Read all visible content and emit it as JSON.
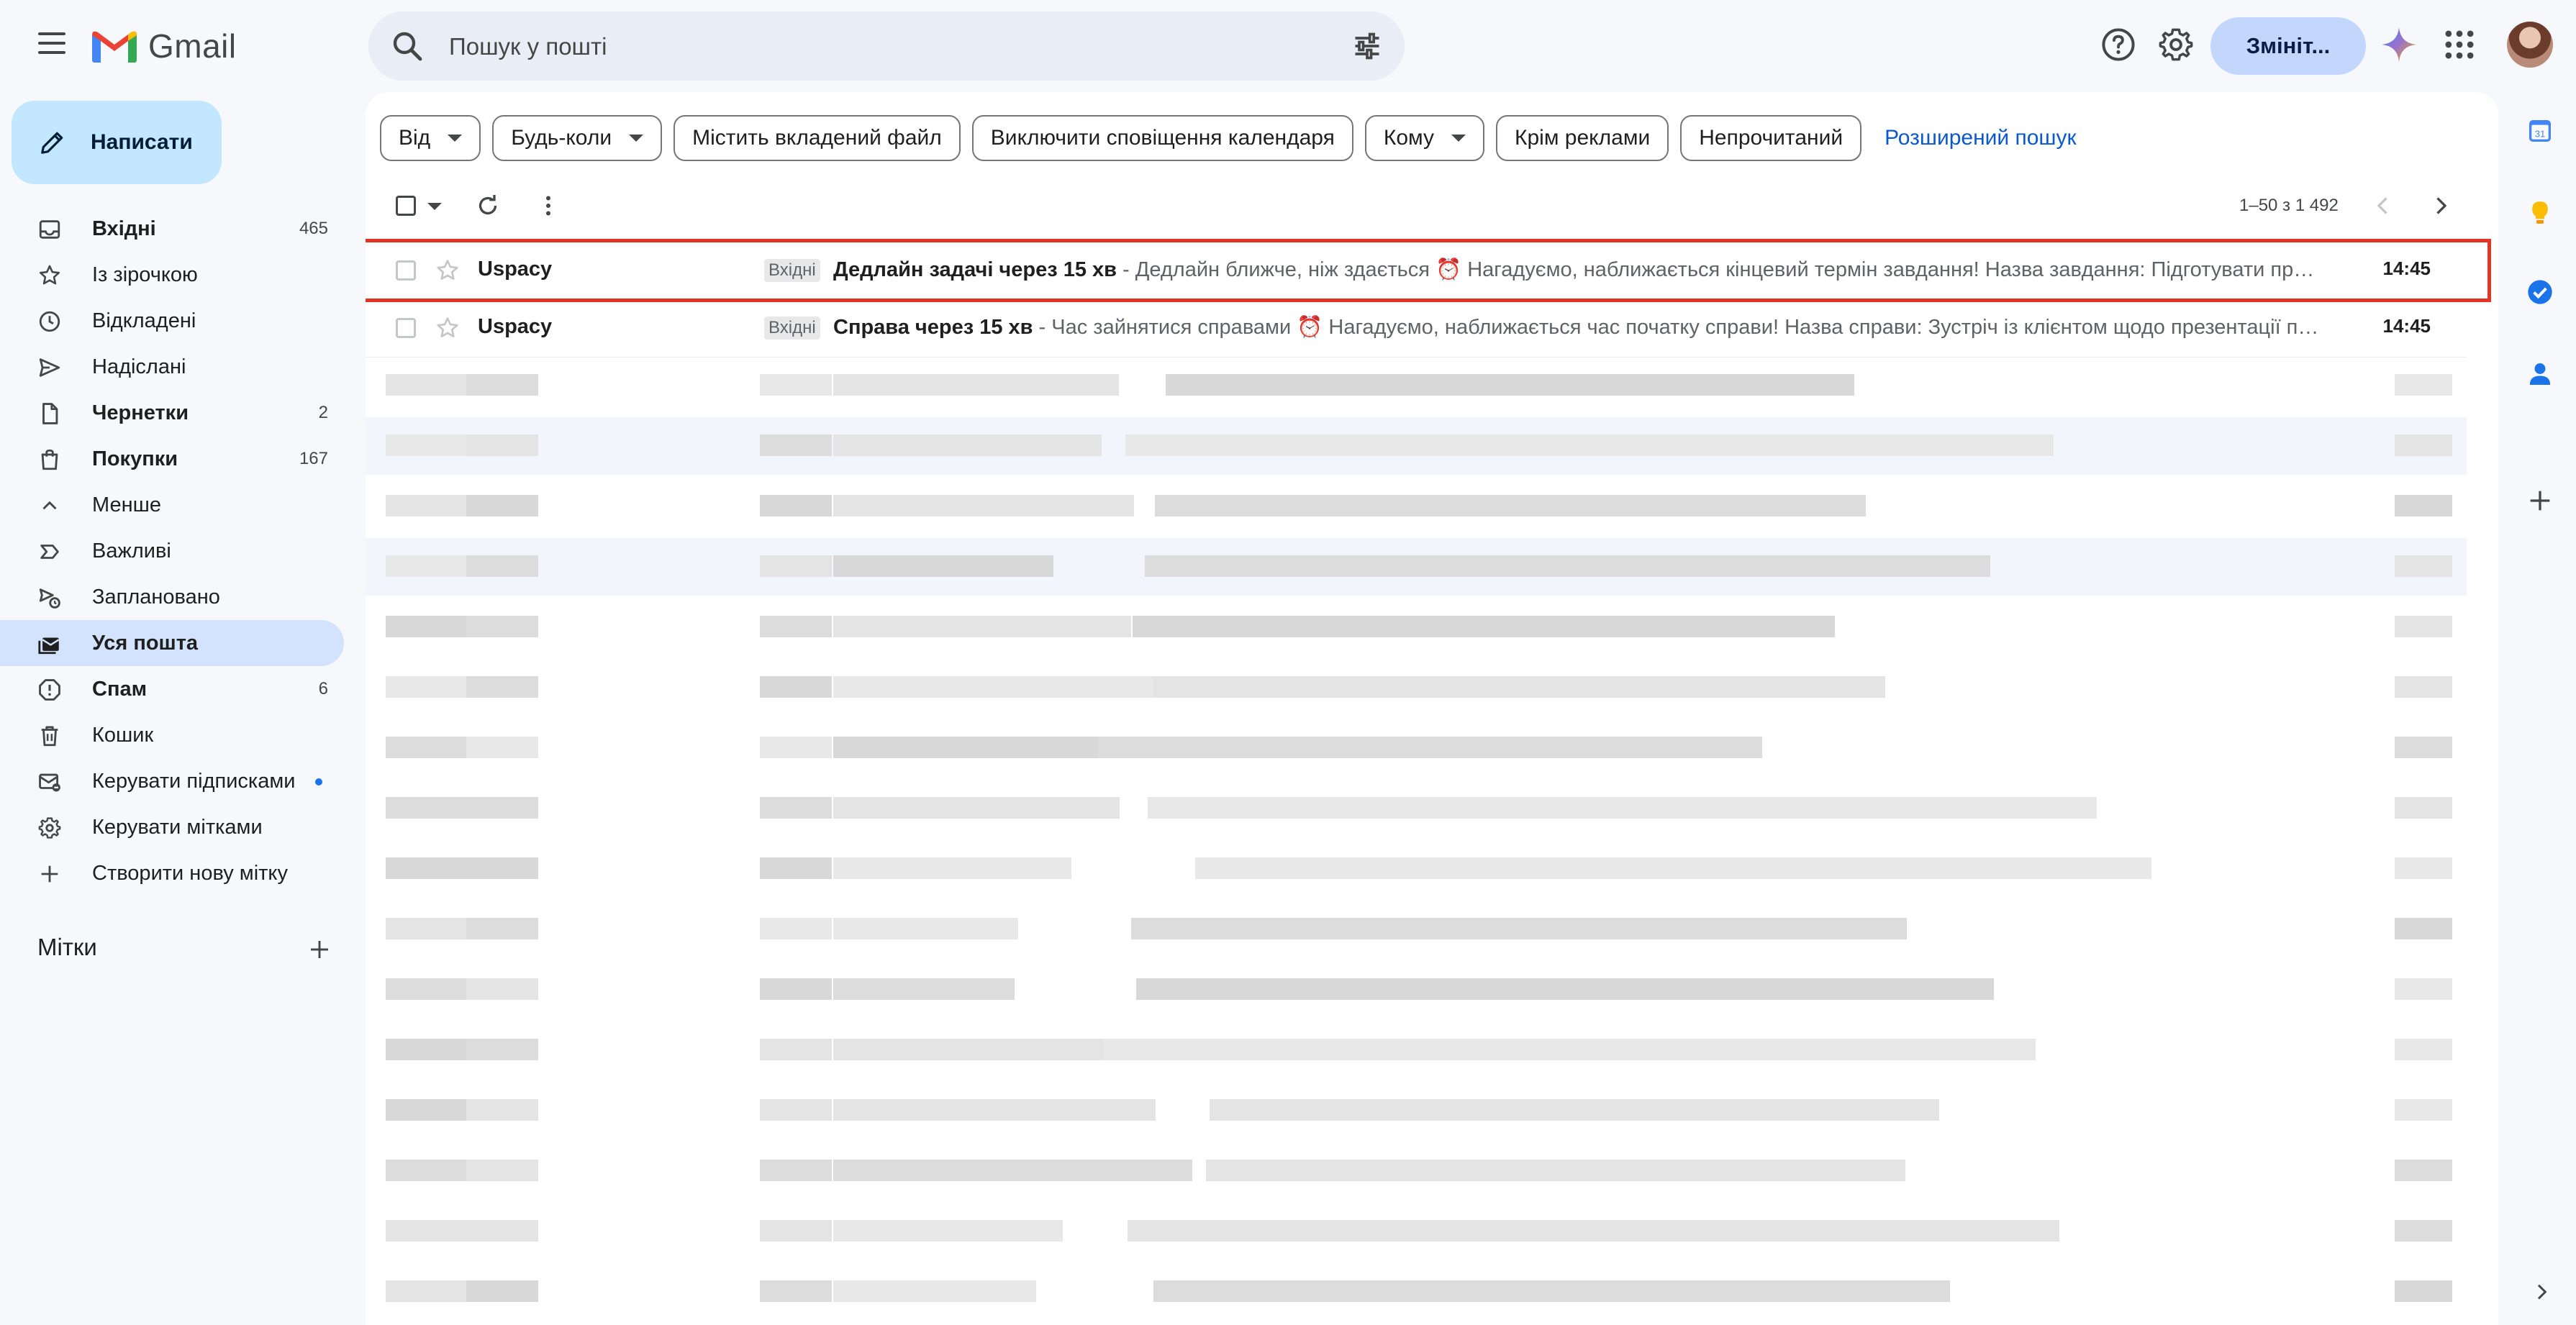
{
  "app": {
    "name": "Gmail"
  },
  "search": {
    "placeholder": "Пошук у пошті"
  },
  "header": {
    "switch_button": "Змініт..."
  },
  "compose": {
    "label": "Написати"
  },
  "sidebar": {
    "items": [
      {
        "label": "Вхідні",
        "count": "465",
        "icon": "inbox-icon",
        "bold": true
      },
      {
        "label": "Із зірочкою",
        "count": "",
        "icon": "star-icon"
      },
      {
        "label": "Відкладені",
        "count": "",
        "icon": "clock-icon"
      },
      {
        "label": "Надіслані",
        "count": "",
        "icon": "send-icon"
      },
      {
        "label": "Чернетки",
        "count": "2",
        "icon": "draft-icon",
        "bold": true
      },
      {
        "label": "Покупки",
        "count": "167",
        "icon": "shopping-bag-icon",
        "bold": true
      },
      {
        "label": "Менше",
        "count": "",
        "icon": "chevron-up-icon"
      },
      {
        "label": "Важливі",
        "count": "",
        "icon": "important-icon"
      },
      {
        "label": "Заплановано",
        "count": "",
        "icon": "scheduled-icon"
      },
      {
        "label": "Уся пошта",
        "count": "",
        "icon": "all-mail-icon",
        "active": true
      },
      {
        "label": "Спам",
        "count": "6",
        "icon": "spam-icon",
        "bold": true
      },
      {
        "label": "Кошик",
        "count": "",
        "icon": "trash-icon"
      },
      {
        "label": "Керувати підписками",
        "count": "",
        "icon": "subscriptions-icon"
      },
      {
        "label": "Керувати мітками",
        "count": "",
        "icon": "gear-icon"
      },
      {
        "label": "Створити нову мітку",
        "count": "",
        "icon": "plus-icon"
      }
    ],
    "labels_heading": "Мітки"
  },
  "filters": {
    "chips": [
      {
        "label": "Від",
        "dropdown": true
      },
      {
        "label": "Будь-коли",
        "dropdown": true
      },
      {
        "label": "Містить вкладений файл",
        "dropdown": false
      },
      {
        "label": "Виключити сповіщення календаря",
        "dropdown": false
      },
      {
        "label": "Кому",
        "dropdown": true
      },
      {
        "label": "Крім реклами",
        "dropdown": false
      },
      {
        "label": "Непрочитаний",
        "dropdown": false
      }
    ],
    "advanced_search": "Розширений пошук"
  },
  "pagination": {
    "range": "1–50 з 1 492"
  },
  "emails": [
    {
      "sender": "Uspacy",
      "label": "Вхідні",
      "subject": "Дедлайн задачі через 15 хв",
      "snippet": " - Дедлайн ближче, ніж здається ⏰ Нагадуємо, наближається кінцевий термін завдання! Назва завдання: Підготувати презен…",
      "time": "14:45",
      "highlighted": true
    },
    {
      "sender": "Uspacy",
      "label": "Вхідні",
      "subject": "Справа через 15 хв",
      "snippet": " - Час зайнятися справами ⏰ Нагадуємо, наближається час початку справи! Назва справи: Зустріч із клієнтом щодо презентації проє…",
      "time": "14:45",
      "highlighted": false
    }
  ],
  "colors": {
    "accent": "#0b57d0",
    "compose_bg": "#c2e7ff",
    "active_nav": "#d3e3fd",
    "highlight_box": "#e33426"
  }
}
